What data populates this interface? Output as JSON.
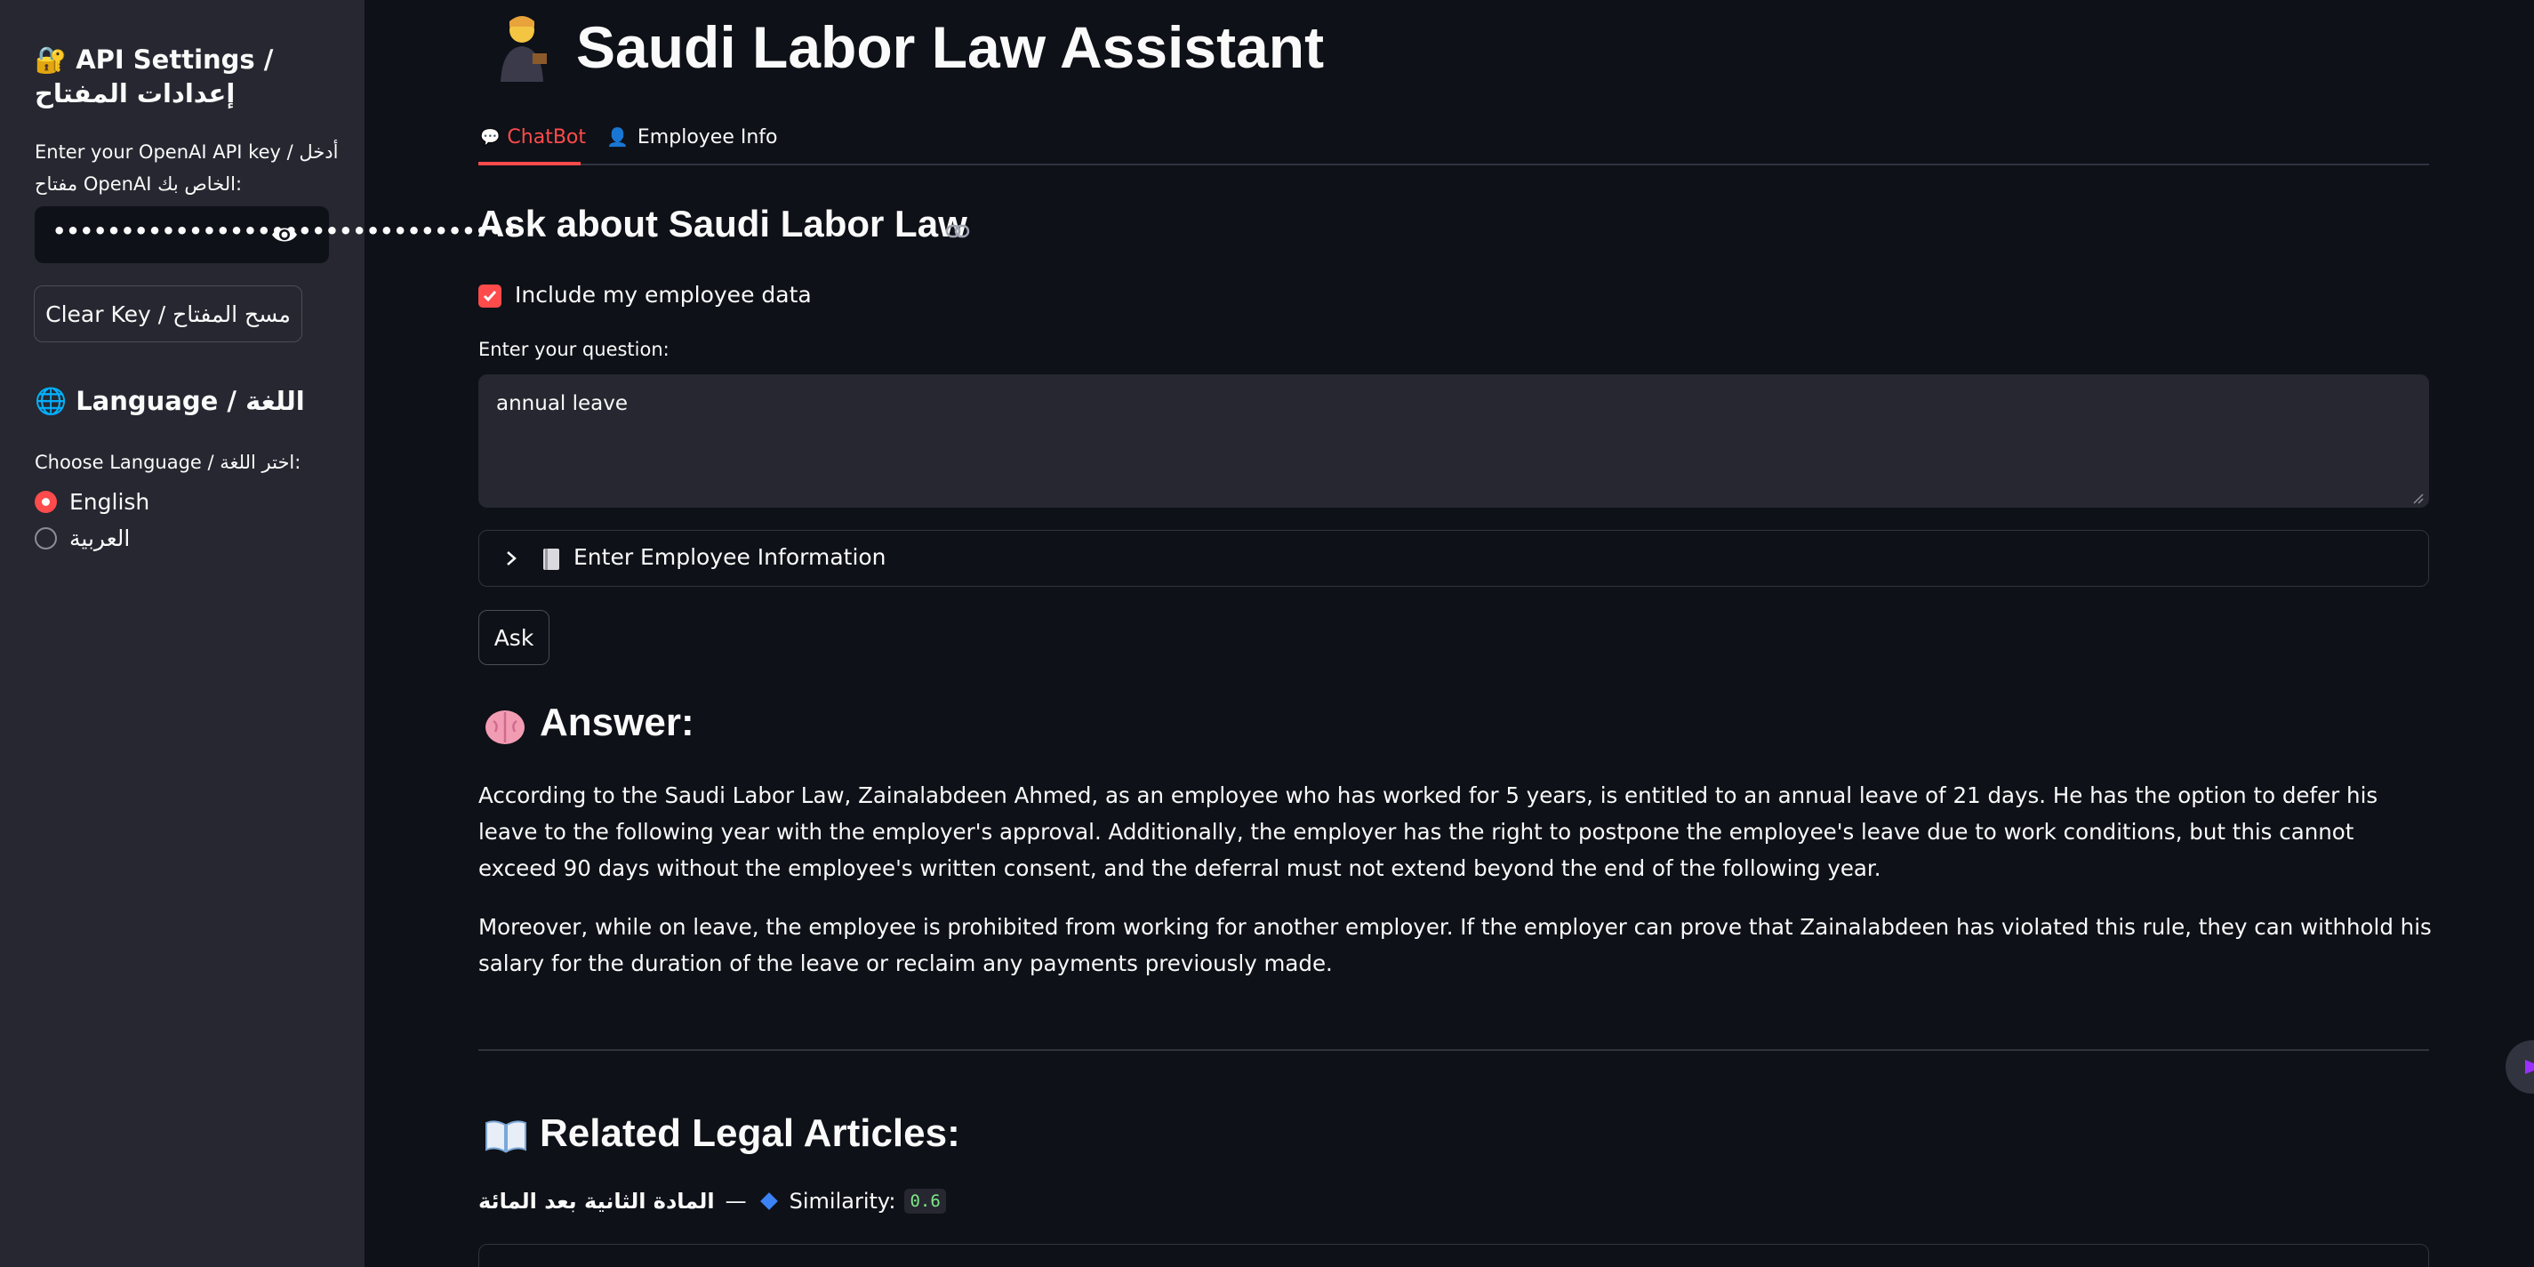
{
  "sidebar": {
    "api_title": "🔐 API Settings / إعدادات المفتاح",
    "api_key_label": "Enter your OpenAI API key / أدخل مفتاح OpenAI الخاص بك:",
    "api_key_value": "••••••••••••••••••••••••••••••••••",
    "clear_key_label": "Clear Key / مسح المفتاح",
    "language_title": "🌐 Language / اللغة",
    "language_label": "Choose Language / اختر اللغة:",
    "language_options": [
      "English",
      "العربية"
    ],
    "language_selected": "English"
  },
  "main": {
    "title": "Saudi Labor Law Assistant",
    "tabs": [
      {
        "label": "ChatBot",
        "icon": "💬",
        "active": true
      },
      {
        "label": "Employee Info",
        "icon": "👤",
        "active": false
      }
    ],
    "section_title": "Ask about Saudi Labor Law",
    "include_employee_data_label": "Include my employee data",
    "include_employee_data_checked": true,
    "question_label": "Enter your question:",
    "question_value": "annual leave",
    "expander_label": "Enter Employee Information",
    "ask_label": "Ask",
    "answer_title": "Answer:",
    "answer_paragraphs": [
      "According to the Saudi Labor Law, Zainalabdeen Ahmed, as an employee who has worked for 5 years, is entitled to an annual leave of 21 days. He has the option to defer his leave to the following year with the employer's approval. Additionally, the employer has the right to postpone the employee's leave due to work conditions, but this cannot exceed 90 days without the employee's written consent, and the deferral must not extend beyond the end of the following year.",
      "Moreover, while on leave, the employee is prohibited from working for another employer. If the employer can prove that Zainalabdeen has violated this rule, they can withhold his salary for the duration of the leave or reclaim any payments previously made."
    ],
    "related_title": "Related Legal Articles:",
    "related_article_name": "المادة الثانية بعد المائة",
    "related_separator": "—",
    "similarity_label": "Similarity:",
    "similarity_value": "0.6"
  },
  "colors": {
    "accent": "#ff4b4b",
    "background": "#0e1117",
    "sidebar": "#262730"
  }
}
